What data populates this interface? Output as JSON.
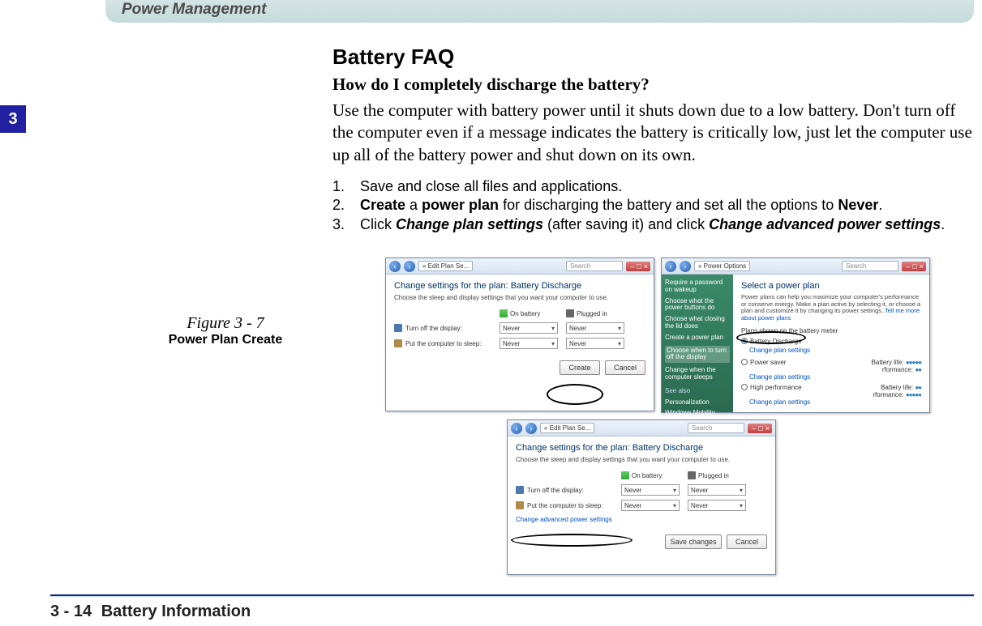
{
  "header": {
    "title": "Power Management"
  },
  "chapter_tab": "3",
  "article": {
    "title": "Battery FAQ",
    "subtitle": "How do I completely discharge the battery?",
    "paragraph": "Use the computer with battery power until it shuts down due to a low battery. Don't turn off the computer even if a message indicates the battery is critically low, just let the computer use up all of the battery power and shut down on its own.",
    "steps": [
      {
        "num": "1.",
        "text_plain": "Save and close all files and applications."
      },
      {
        "num": "2.",
        "b1": "Create",
        "mid": " a ",
        "b2": "power plan",
        "tail": " for discharging the battery and set all the options to ",
        "b3": "Never",
        "end": "."
      },
      {
        "num": "3.",
        "pre": "Click ",
        "bi1": "Change plan settings",
        "mid": " (after saving it) and click ",
        "bi2": "Change advanced power settings",
        "end": "."
      }
    ]
  },
  "figure": {
    "number": "Figure 3 - 7",
    "title": "Power Plan Create"
  },
  "windows": {
    "addr_edit": "« Edit Plan Se...",
    "addr_power": "« Power Options",
    "search": "Search",
    "plan_heading": "Change settings for the plan: Battery Discharge",
    "plan_sub": "Choose the sleep and display settings that you want your computer to use.",
    "col_onbattery": "On battery",
    "col_plugged": "Plugged in",
    "row_display": "Turn off the display:",
    "row_sleep": "Put the computer to sleep:",
    "never": "Never",
    "btn_create": "Create",
    "btn_cancel": "Cancel",
    "btn_save": "Save changes",
    "select_heading": "Select a power plan",
    "select_desc": "Power plans can help you maximize your computer's performance or conserve energy. Make a plan active by selecting it, or choose a plan and customize it by changing its power settings.",
    "select_link": "Tell me more about power plans",
    "plans_shown": "Plans shown on the battery meter",
    "plan_bd": "Battery Discharge",
    "plan_ps": "Power saver",
    "plan_hp": "High performance",
    "change_link": "Change plan settings",
    "perf_label": "Battery life:",
    "perf_label2": "rformance:",
    "adv_link": "Change advanced power settings",
    "side_items": [
      "Require a password on wakeup",
      "Choose what the power buttons do",
      "Choose what closing the lid does",
      "Create a power plan",
      "Choose when to turn off the display",
      "Change when the computer sleeps"
    ],
    "side_seealso": "See also",
    "side_pers": "Personalization",
    "side_wmc": "Windows Mobility Center"
  },
  "footer": {
    "page": "3 - 14",
    "section": "Battery Information"
  }
}
